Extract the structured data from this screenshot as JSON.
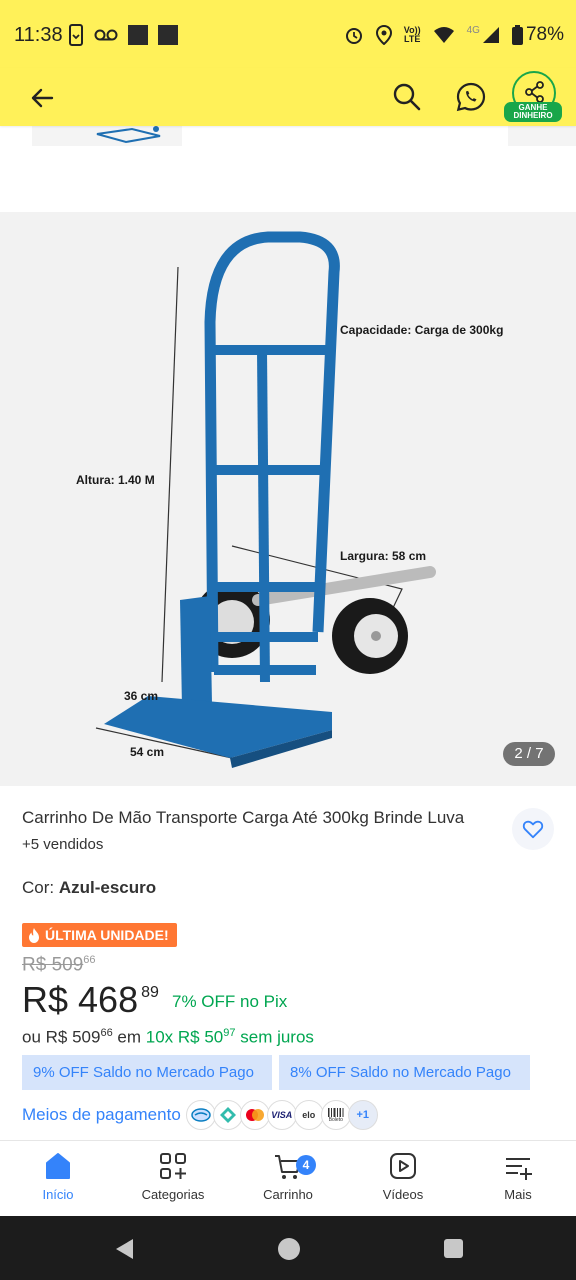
{
  "status_bar": {
    "time": "11:38",
    "battery": "78%",
    "network": "4G",
    "volte_line1": "Vo))",
    "volte_line2": "LTE"
  },
  "app_bar": {
    "earn_badge_line1": "GANHE",
    "earn_badge_line2": "DINHEIRO",
    "icons": [
      "back-arrow-icon",
      "search-icon",
      "whatsapp-icon",
      "share-icon"
    ]
  },
  "gallery": {
    "counter": "2 / 7",
    "labels": {
      "capacity": "Capacidade: Carga de 300kg",
      "height": "Altura:  1.40 M",
      "width": "Largura: 58 cm",
      "depth": "36 cm",
      "base": "54 cm"
    }
  },
  "product": {
    "title": "Carrinho De Mão Transporte Carga Até 300kg Brinde Luva",
    "sold": "+5 vendidos",
    "color_label": "Cor: ",
    "color_value": "Azul-escuro",
    "last_unit": "ÚLTIMA UNIDADE!",
    "old_price": "R$ 509",
    "old_price_cents": "66",
    "price": "R$ 468",
    "price_cents": "89",
    "discount_pct": "7% OFF",
    "discount_method": "no Pix",
    "installments_prefix": "ou R$ 509",
    "installments_prefix_cents": "66",
    "installments_em": " em ",
    "installments_value": "10x R$ 50",
    "installments_value_cents": "97",
    "installments_suffix": " sem juros",
    "promo_1": "9% OFF Saldo no Mercado Pago",
    "promo_2": "8% OFF Saldo no Mercado Pago",
    "payment_link": "Meios de pagamento",
    "payment_more": "+1",
    "payment_icons": [
      "mercado-pago-icon",
      "pix-icon",
      "mastercard-icon",
      "visa-icon",
      "elo-icon",
      "boleto-icon"
    ],
    "payment_visa": "VISA",
    "payment_elo": "elo",
    "payment_boleto": "Boleto"
  },
  "bottom_nav": {
    "items": [
      {
        "label": "Início",
        "icon": "home-icon",
        "active": true
      },
      {
        "label": "Categorias",
        "icon": "categories-icon",
        "active": false
      },
      {
        "label": "Carrinho",
        "icon": "cart-icon",
        "active": false,
        "badge": "4"
      },
      {
        "label": "Vídeos",
        "icon": "video-icon",
        "active": false
      },
      {
        "label": "Mais",
        "icon": "menu-plus-icon",
        "active": false
      }
    ]
  },
  "colors": {
    "header_yellow": "#FFF159",
    "accent_blue": "#3483fa",
    "discount_green": "#00a650",
    "last_unit_orange": "#ff7733",
    "product_blue": "#1f6fb2"
  }
}
